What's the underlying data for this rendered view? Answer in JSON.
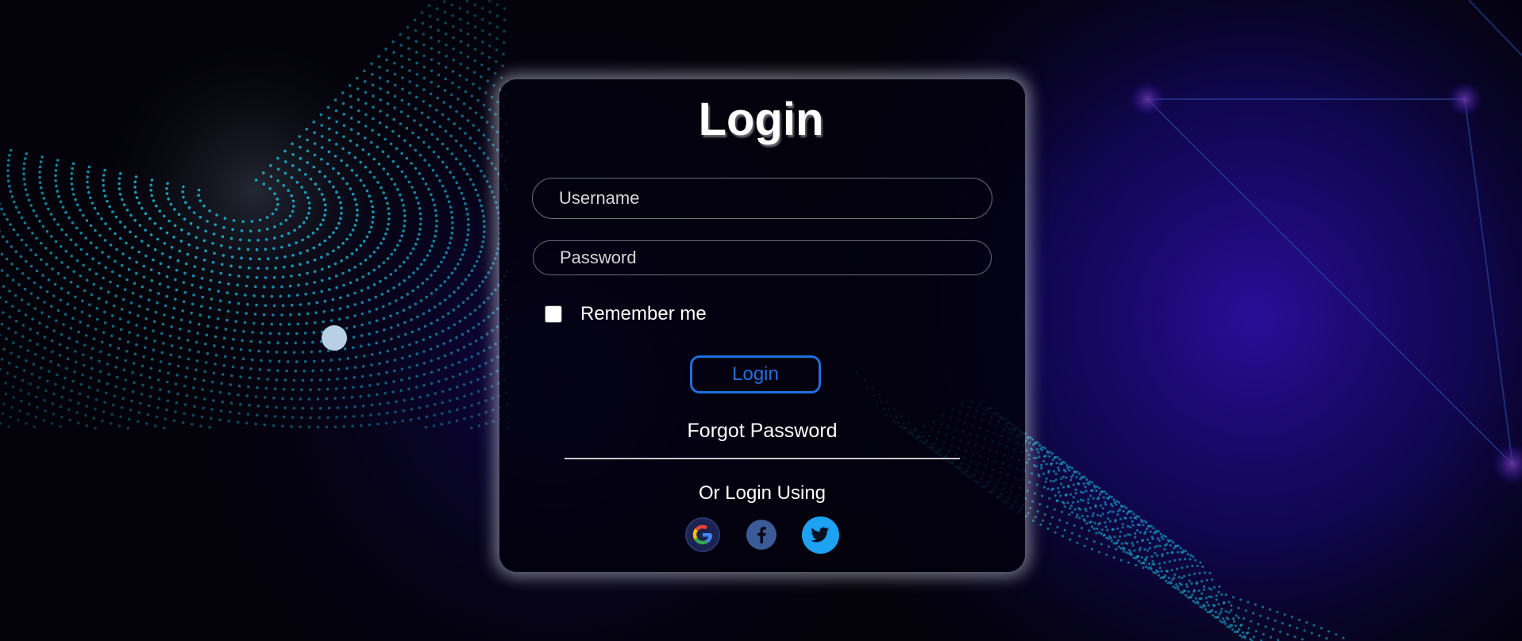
{
  "login": {
    "title": "Login",
    "username_placeholder": "Username",
    "password_placeholder": "Password",
    "remember_label": "Remember me",
    "remember_checked": false,
    "login_button": "Login",
    "forgot_password": "Forgot Password",
    "or_login_using": "Or Login Using"
  },
  "social": [
    {
      "name": "google",
      "icon": "google-icon"
    },
    {
      "name": "facebook",
      "icon": "facebook-icon"
    },
    {
      "name": "twitter",
      "icon": "twitter-icon"
    }
  ],
  "colors": {
    "background": "#03020a",
    "accent": "#1f6fe0",
    "particles": "#1ab8d8",
    "glow": "#2a0fa0"
  }
}
